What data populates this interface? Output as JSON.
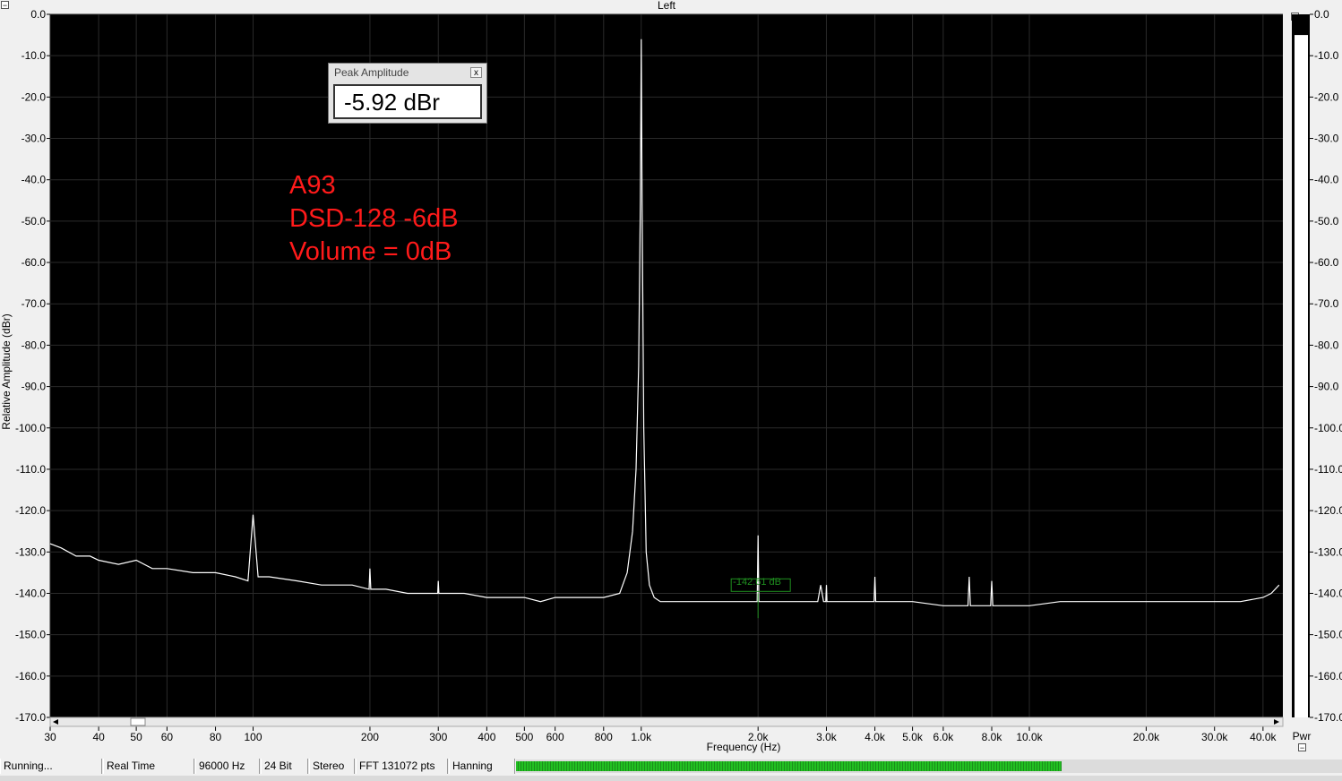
{
  "window": {
    "title": "Left"
  },
  "peak_box": {
    "title": "Peak Amplitude",
    "value": "-5.92 dBr",
    "close_label": "x"
  },
  "annotation": {
    "line1": "A93",
    "line2": "DSD-128 -6dB",
    "line3": "Volume = 0dB"
  },
  "cursor_label": "-142.61 dB",
  "colors": {
    "plot_bg": "#000000",
    "trace": "#ffffff",
    "grid": "#2a2a2a",
    "annotation": "#ff1a1a",
    "cursor": "#1f8f1f",
    "meter": "#22c022"
  },
  "chart_data": {
    "type": "line",
    "xlabel": "Frequency (Hz)",
    "ylabel": "Relative Amplitude (dBr)",
    "x_scale": "log",
    "xlim": [
      30,
      45000
    ],
    "ylim": [
      -170,
      0
    ],
    "grid": true,
    "x_ticks": [
      {
        "value": 30,
        "label": "30"
      },
      {
        "value": 40,
        "label": "40"
      },
      {
        "value": 50,
        "label": "50"
      },
      {
        "value": 60,
        "label": "60"
      },
      {
        "value": 80,
        "label": "80"
      },
      {
        "value": 100,
        "label": "100"
      },
      {
        "value": 200,
        "label": "200"
      },
      {
        "value": 300,
        "label": "300"
      },
      {
        "value": 400,
        "label": "400"
      },
      {
        "value": 500,
        "label": "500"
      },
      {
        "value": 600,
        "label": "600"
      },
      {
        "value": 800,
        "label": "800"
      },
      {
        "value": 1000,
        "label": "1.0k"
      },
      {
        "value": 2000,
        "label": "2.0k"
      },
      {
        "value": 3000,
        "label": "3.0k"
      },
      {
        "value": 4000,
        "label": "4.0k"
      },
      {
        "value": 5000,
        "label": "5.0k"
      },
      {
        "value": 6000,
        "label": "6.0k"
      },
      {
        "value": 8000,
        "label": "8.0k"
      },
      {
        "value": 10000,
        "label": "10.0k"
      },
      {
        "value": 20000,
        "label": "20.0k"
      },
      {
        "value": 30000,
        "label": "30.0k"
      },
      {
        "value": 40000,
        "label": "40.0k"
      }
    ],
    "y_ticks": [
      {
        "value": 0,
        "label": "0.0"
      },
      {
        "value": -10,
        "label": "-10.0"
      },
      {
        "value": -20,
        "label": "-20.0"
      },
      {
        "value": -30,
        "label": "-30.0"
      },
      {
        "value": -40,
        "label": "-40.0"
      },
      {
        "value": -50,
        "label": "-50.0"
      },
      {
        "value": -60,
        "label": "-60.0"
      },
      {
        "value": -70,
        "label": "-70.0"
      },
      {
        "value": -80,
        "label": "-80.0"
      },
      {
        "value": -90,
        "label": "-90.0"
      },
      {
        "value": -100,
        "label": "-100.0"
      },
      {
        "value": -110,
        "label": "-110.0"
      },
      {
        "value": -120,
        "label": "-120.0"
      },
      {
        "value": -130,
        "label": "-130.0"
      },
      {
        "value": -140,
        "label": "-140.0"
      },
      {
        "value": -150,
        "label": "-150.0"
      },
      {
        "value": -160,
        "label": "-160.0"
      },
      {
        "value": -170,
        "label": "-170.0"
      }
    ],
    "series": [
      {
        "x": [
          30,
          32,
          35,
          38,
          40,
          45,
          50,
          55,
          60,
          70,
          80,
          90,
          97,
          100,
          103,
          110,
          130,
          150,
          180,
          199,
          200,
          201,
          220,
          250,
          299,
          300,
          301,
          350,
          400,
          450,
          500,
          550,
          600,
          700,
          800,
          880,
          920,
          950,
          970,
          985,
          995,
          1000,
          1005,
          1015,
          1030,
          1050,
          1080,
          1120,
          1200,
          1300,
          1500,
          1700,
          1990,
          2000,
          2010,
          2300,
          2600,
          2850,
          2900,
          2950,
          2990,
          3000,
          3010,
          3400,
          3980,
          4000,
          4020,
          5000,
          6000,
          6950,
          7000,
          7050,
          7950,
          8000,
          8050,
          10000,
          12000,
          15000,
          20000,
          25000,
          30000,
          35000,
          40000,
          42000,
          44000
        ],
        "y": [
          -128,
          -129,
          -131,
          -131,
          -132,
          -133,
          -132,
          -134,
          -134,
          -135,
          -135,
          -136,
          -137,
          -121,
          -136,
          -136,
          -137,
          -138,
          -138,
          -139,
          -134,
          -139,
          -139,
          -140,
          -140,
          -137,
          -140,
          -140,
          -141,
          -141,
          -141,
          -142,
          -141,
          -141,
          -141,
          -140,
          -135,
          -125,
          -110,
          -85,
          -45,
          -6,
          -45,
          -100,
          -130,
          -138,
          -141,
          -142,
          -142,
          -142,
          -142,
          -142,
          -142,
          -126,
          -142,
          -142,
          -142,
          -142,
          -138,
          -142,
          -142,
          -138,
          -142,
          -142,
          -142,
          -136,
          -142,
          -142,
          -143,
          -143,
          -136,
          -143,
          -143,
          -137,
          -143,
          -143,
          -142,
          -142,
          -142,
          -142,
          -142,
          -142,
          -141,
          -140,
          -138
        ]
      }
    ],
    "cursor": {
      "x": 2000,
      "label": "-142.61 dB"
    },
    "pwr_meter": {
      "label": "Pwr",
      "ylim": [
        -170,
        0
      ],
      "level": -5
    }
  },
  "status_bar": {
    "state": "Running...",
    "mode": "Real Time",
    "sample_rate": "96000 Hz",
    "bit_depth": "24 Bit",
    "channels": "Stereo",
    "fft": "FFT 131072 pts",
    "window": "Hanning",
    "level_fraction": 0.66
  }
}
